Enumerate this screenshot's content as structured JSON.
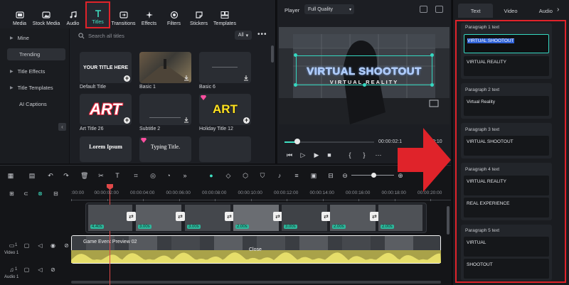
{
  "media_toolbar": {
    "items": [
      {
        "label": "Media",
        "icon": "media-icon"
      },
      {
        "label": "Stock Media",
        "icon": "stock-media-icon"
      },
      {
        "label": "Audio",
        "icon": "audio-icon"
      },
      {
        "label": "Titles",
        "icon": "titles-icon",
        "active": true
      },
      {
        "label": "Transitions",
        "icon": "transitions-icon"
      },
      {
        "label": "Effects",
        "icon": "effects-icon"
      },
      {
        "label": "Filters",
        "icon": "filters-icon"
      },
      {
        "label": "Stickers",
        "icon": "stickers-icon"
      },
      {
        "label": "Templates",
        "icon": "templates-icon"
      }
    ]
  },
  "sidebar": {
    "items": [
      {
        "label": "Mine",
        "expandable": true
      },
      {
        "label": "Trending",
        "active": true
      },
      {
        "label": "Title Effects",
        "expandable": true
      },
      {
        "label": "Title Templates",
        "expandable": true
      },
      {
        "label": "AI Captions"
      }
    ]
  },
  "search": {
    "placeholder": "Search all titles",
    "filter": "All"
  },
  "titles": [
    {
      "name": "Default Title",
      "preview": "YOUR TITLE HERE"
    },
    {
      "name": "Basic 1",
      "preview": ""
    },
    {
      "name": "Basic 6",
      "preview": ""
    },
    {
      "name": "Art Title 26",
      "preview": "ART"
    },
    {
      "name": "Subtitle 2",
      "preview": ""
    },
    {
      "name": "Holiday Title 12",
      "preview": "ART"
    },
    {
      "name": "",
      "preview": "Lorem Ipsum"
    },
    {
      "name": "",
      "preview": "Typing Title."
    },
    {
      "name": "",
      "preview": ""
    }
  ],
  "player": {
    "label": "Player",
    "quality": "Full Quality",
    "overlay_title": "VIRTUAL SHOOTOUT",
    "overlay_subtitle": "VIRTUAL REALITY",
    "time_current": "00:00:02:1",
    "time_total": "0:10",
    "progress": 0.14
  },
  "properties": {
    "tabs": [
      "Text",
      "Video",
      "Audio"
    ],
    "active_tab": "Text",
    "paragraphs": [
      {
        "label": "Paragraph 1 text",
        "lines": [
          "VIRTUAL SHOOTOUT",
          "VIRTUAL REALITY"
        ]
      },
      {
        "label": "Paragraph 2 text",
        "lines": [
          "Virtual Reality"
        ]
      },
      {
        "label": "Paragraph 3 text",
        "lines": [
          "VIRTUAL SHOOTOUT"
        ]
      },
      {
        "label": "Paragraph 4 text",
        "lines": [
          "VIRTUAL REALITY",
          "REAL EXPERIENCE"
        ]
      },
      {
        "label": "Paragraph 5 text",
        "lines": [
          "VIRTUAL",
          "SHOOTOUT"
        ]
      }
    ]
  },
  "timeline": {
    "ticks": [
      ":00:00",
      "00:00:02:00",
      "00:00:04:00",
      "00:00:06:00",
      "00:00:08:00",
      "00:00:10:00",
      "00:00:12:00",
      "00:00:14:00",
      "00:00:16:00",
      "00:00:18:00",
      "00:00:20:00"
    ],
    "clips": [
      {
        "duration": "4.40s"
      },
      {
        "duration": "3.00s"
      },
      {
        "duration": "3.00s"
      },
      {
        "duration": "2.00s"
      },
      {
        "duration": "3.00s"
      },
      {
        "duration": "2.00s"
      },
      {
        "duration": "2.00s"
      }
    ],
    "video_clip_label": "Game Event Preview 02",
    "close_label": "Close",
    "track_video": "Video 1",
    "track_audio": "Audio 1",
    "track_video_index": "1",
    "track_audio_index": "1"
  },
  "colors": {
    "accent": "#3fe0c2",
    "highlight_red": "#e0232a",
    "selection_blue": "#2f62d6"
  }
}
